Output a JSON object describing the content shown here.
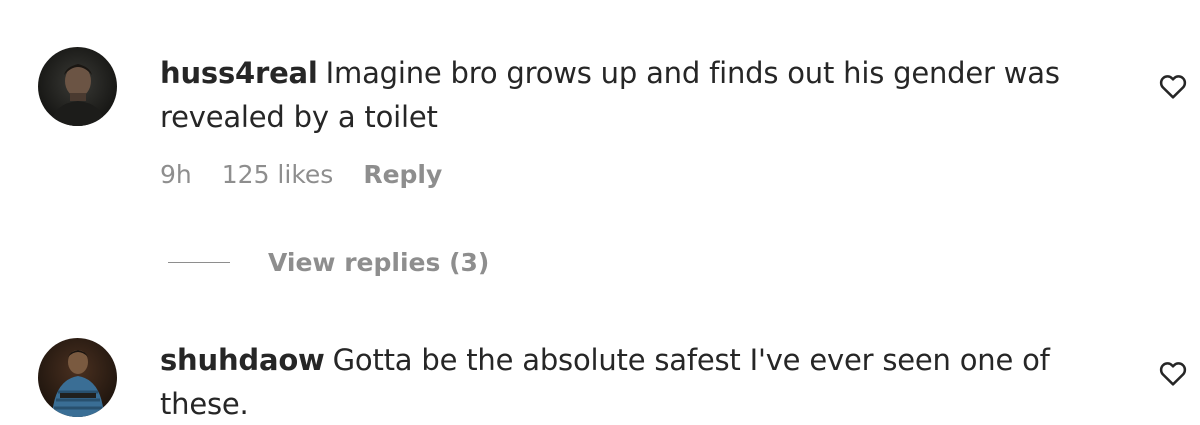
{
  "comments": [
    {
      "username": "huss4real",
      "text": "Imagine bro grows up and finds out his gender was revealed by a toilet",
      "time": "9h",
      "likes": "125 likes",
      "reply_label": "Reply",
      "view_replies": "View replies (3)",
      "avatar_icon": "avatar-person-dark",
      "like_icon": "heart-outline-icon"
    },
    {
      "username": "shuhdaow",
      "text": "Gotta be the absolute safest I've ever seen one of these.",
      "avatar_icon": "avatar-person-blue-shirt",
      "like_icon": "heart-outline-icon"
    }
  ],
  "colors": {
    "primary_text": "#262626",
    "secondary_text": "#8e8e8e",
    "background": "#ffffff"
  }
}
